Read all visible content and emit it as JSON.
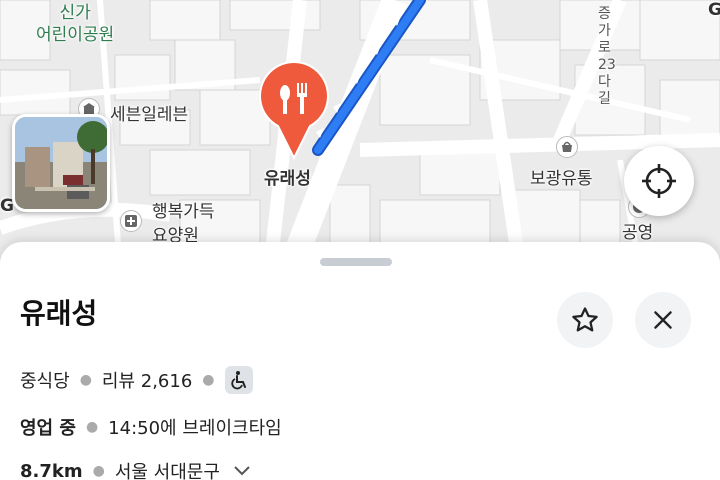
{
  "map": {
    "labels": {
      "park": "신가\n어린이공원",
      "seven_eleven": "세븐일레븐",
      "haengbok": "행복가득\n요양원",
      "bogwang": "보광유통",
      "gongyeong": "공영",
      "street": "증가로23다길",
      "edge_left": "G",
      "edge_right": "G"
    },
    "pin": {
      "icon": "restaurant-fork-spoon-icon",
      "color": "#ef5a3c",
      "label": "유래성"
    },
    "route_color": "#1d6ff2"
  },
  "sheet": {
    "place_name": "유래성",
    "category": "중식당",
    "reviews": "리뷰 2,616",
    "accessibility_icon": "wheelchair-icon",
    "status": "영업 중",
    "hours": "14:50에 브레이크타임",
    "distance": "8.7km",
    "address": "서울 서대문구"
  }
}
